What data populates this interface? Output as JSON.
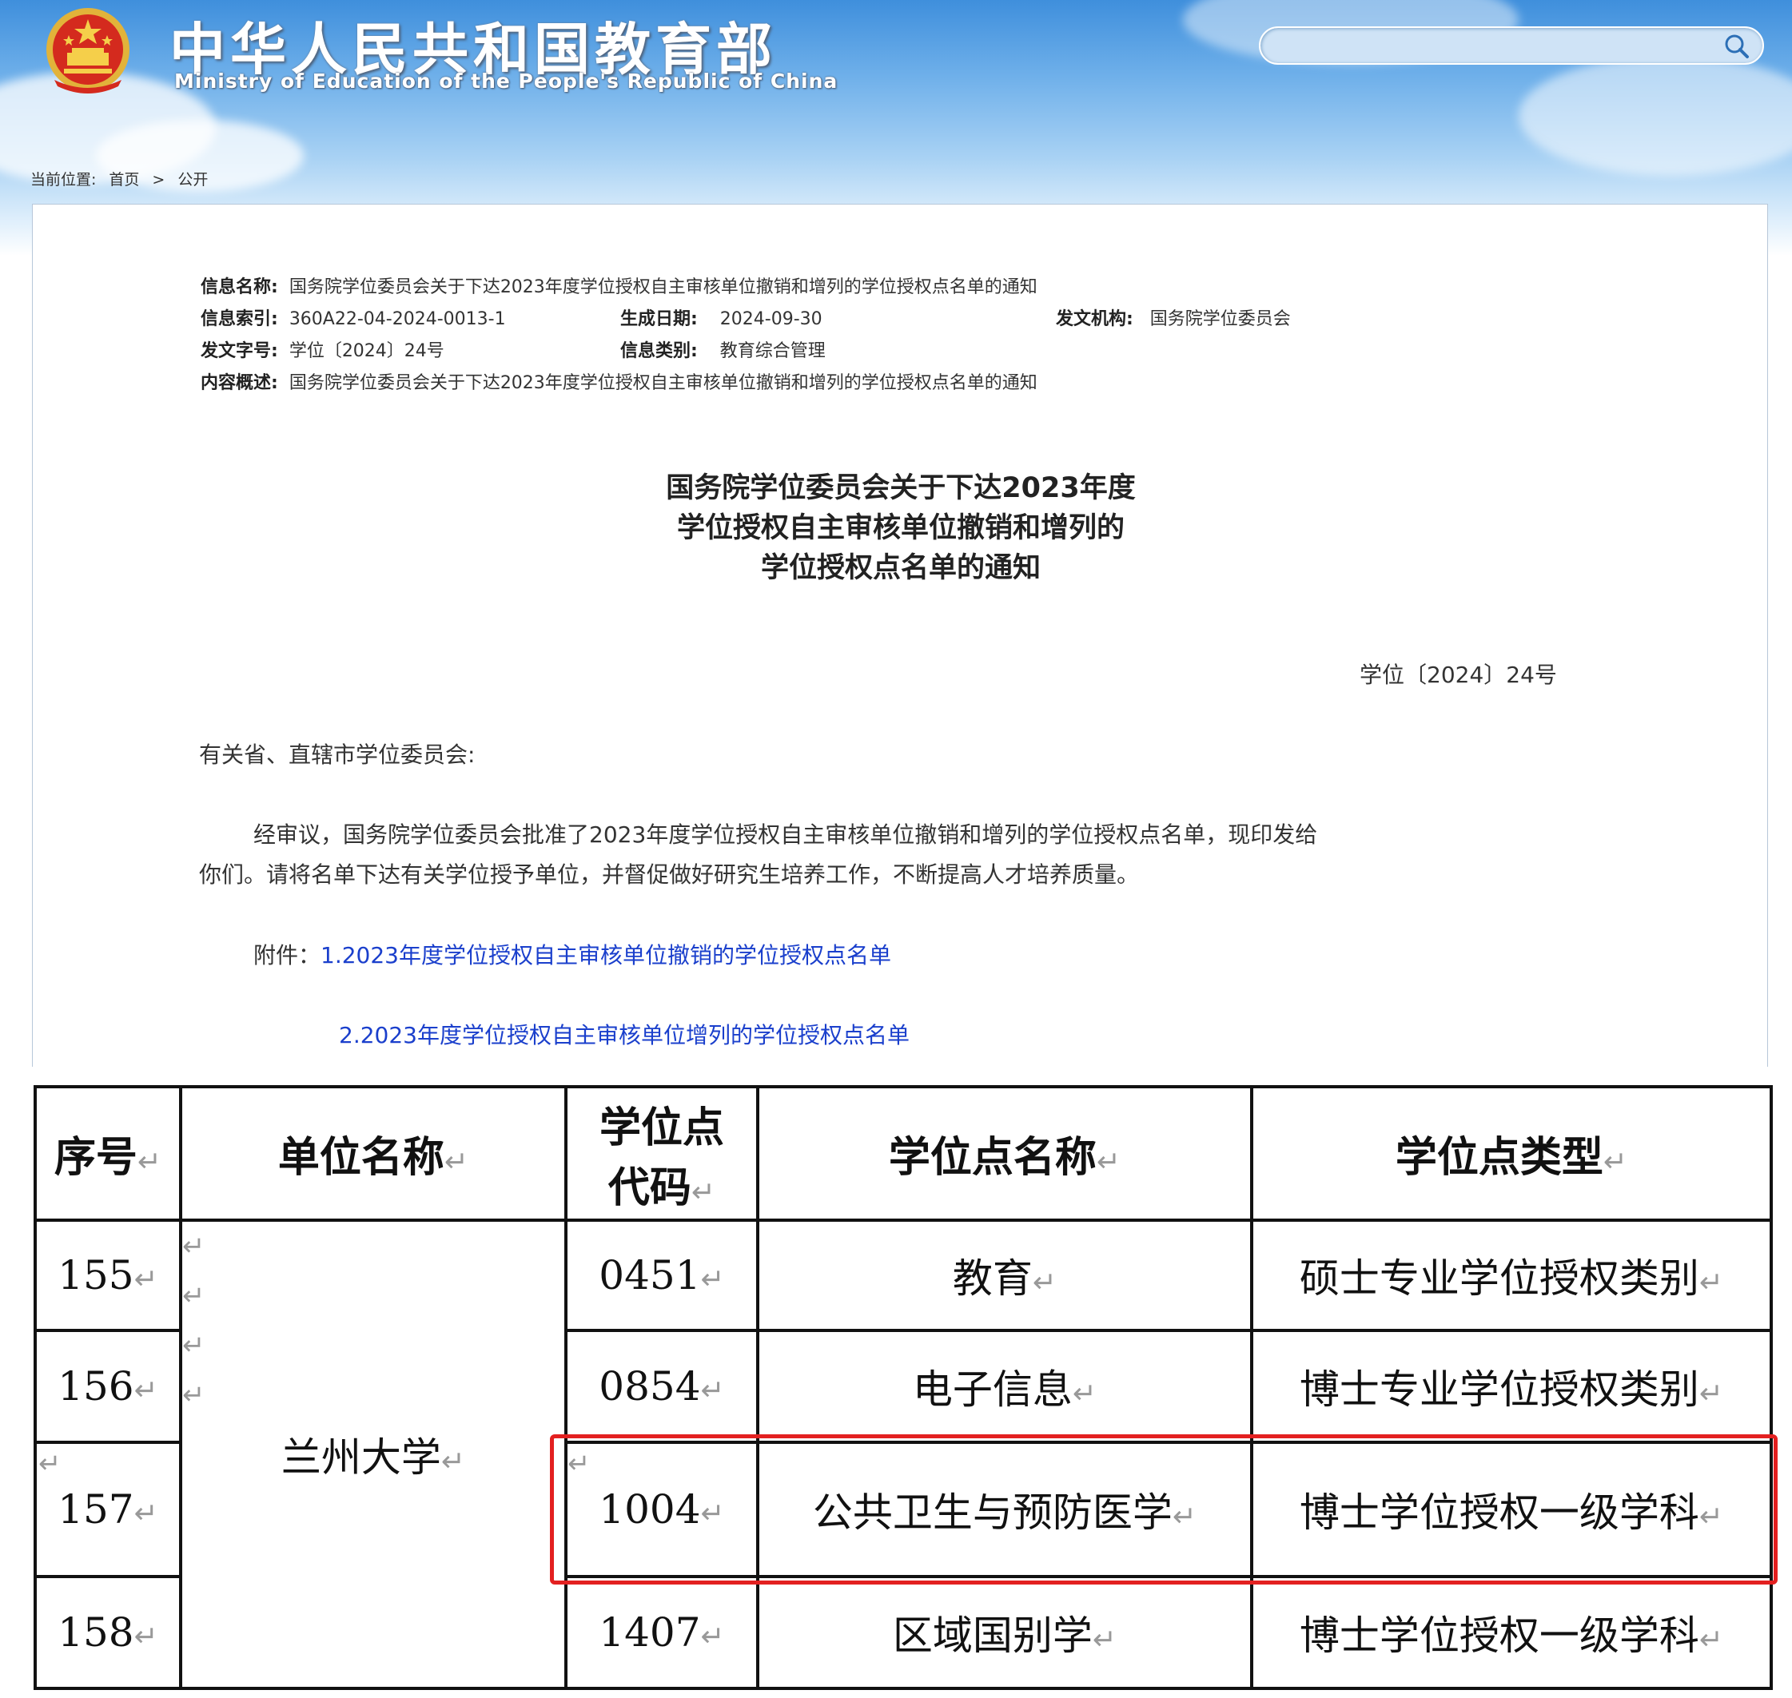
{
  "header": {
    "site_title": "中华人民共和国教育部",
    "site_subtitle": "Ministry of Education of the People's Republic of China",
    "search_placeholder": ""
  },
  "breadcrumb": {
    "label": "当前位置:",
    "home": "首页",
    "sep": ">",
    "current": "公开"
  },
  "info": {
    "name_label": "信息名称:",
    "name_value": "国务院学位委员会关于下达2023年度学位授权自主审核单位撤销和增列的学位授权点名单的通知",
    "index_label": "信息索引:",
    "index_value": "360A22-04-2024-0013-1",
    "date_label": "生成日期:",
    "date_value": "2024-09-30",
    "issuer_label": "发文机构:",
    "issuer_value": "国务院学位委员会",
    "docno_label": "发文字号:",
    "docno_value": "学位〔2024〕24号",
    "category_label": "信息类别:",
    "category_value": "教育综合管理",
    "summary_label": "内容概述:",
    "summary_value": "国务院学位委员会关于下达2023年度学位授权自主审核单位撤销和增列的学位授权点名单的通知"
  },
  "document": {
    "title_lines": [
      "国务院学位委员会关于下达2023年度",
      "学位授权自主审核单位撤销和增列的",
      "学位授权点名单的通知"
    ],
    "doc_number": "学位〔2024〕24号",
    "salutation": "有关省、直辖市学位委员会:",
    "body_line1": "经审议，国务院学位委员会批准了2023年度学位授权自主审核单位撤销和增列的学位授权点名单，现印发给",
    "body_line2": "你们。请将名单下达有关学位授予单位，并督促做好研究生培养工作，不断提高人才培养质量。",
    "attachment_label": "附件：",
    "attachment_1": "1.2023年度学位授权自主审核单位撤销的学位授权点名单",
    "attachment_2": "2.2023年度学位授权自主审核单位增列的学位授权点名单"
  },
  "table": {
    "headers": {
      "seq": "序号",
      "unit": "单位名称",
      "code_line1": "学位点",
      "code_line2": "代码",
      "name": "学位点名称",
      "type": "学位点类型"
    },
    "para_mark": "↵",
    "unit_name": "兰州大学",
    "rows": [
      {
        "seq": "155",
        "code": "0451",
        "name": "教育",
        "type": "硕士专业学位授权类别"
      },
      {
        "seq": "156",
        "code": "0854",
        "name": "电子信息",
        "type": "博士专业学位授权类别"
      },
      {
        "seq": "157",
        "code": "1004",
        "name": "公共卫生与预防医学",
        "type": "博士学位授权一级学科"
      },
      {
        "seq": "158",
        "code": "1407",
        "name": "区域国别学",
        "type": "博士学位授权一级学科"
      }
    ]
  },
  "colors": {
    "highlight": "#e32020",
    "link": "#1a3fcc",
    "header_blue": "#3f8fdc"
  }
}
